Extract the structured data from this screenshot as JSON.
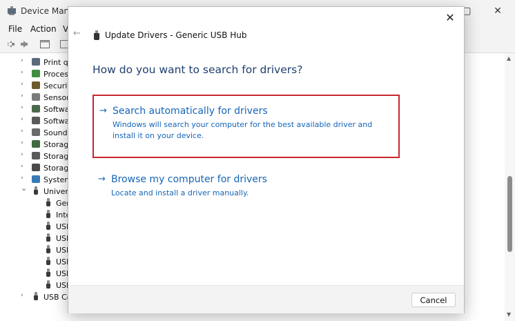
{
  "background_window": {
    "title": "Device Manag",
    "menu": [
      "File",
      "Action",
      "V"
    ],
    "tree_items": [
      {
        "label": "Print qu",
        "indent": 0,
        "expanded": false,
        "icon_color": "#5a6a7a"
      },
      {
        "label": "Process",
        "indent": 0,
        "expanded": false,
        "icon_color": "#3f8f3f"
      },
      {
        "label": "Security",
        "indent": 0,
        "expanded": false,
        "icon_color": "#6b5a2a"
      },
      {
        "label": "Sensors",
        "indent": 0,
        "expanded": false,
        "icon_color": "#7a7a7a"
      },
      {
        "label": "Softwar",
        "indent": 0,
        "expanded": false,
        "icon_color": "#4a6a4a"
      },
      {
        "label": "Softwa",
        "indent": 0,
        "expanded": false,
        "icon_color": "#5a5a5a"
      },
      {
        "label": "Sound,",
        "indent": 0,
        "expanded": false,
        "icon_color": "#6a6a6a"
      },
      {
        "label": "Storage",
        "indent": 0,
        "expanded": false,
        "icon_color": "#3f6a3f"
      },
      {
        "label": "Storage",
        "indent": 0,
        "expanded": false,
        "icon_color": "#5a5a5a"
      },
      {
        "label": "Storage",
        "indent": 0,
        "expanded": false,
        "icon_color": "#4a4a4a"
      },
      {
        "label": "System",
        "indent": 0,
        "expanded": false,
        "icon_color": "#3a7ab8"
      },
      {
        "label": "Univers",
        "indent": 0,
        "expanded": true,
        "icon_color": "usb"
      },
      {
        "label": "Ger",
        "indent": 1,
        "expanded": null,
        "icon_color": "usb"
      },
      {
        "label": "Inte",
        "indent": 1,
        "expanded": null,
        "icon_color": "usb"
      },
      {
        "label": "USB",
        "indent": 1,
        "expanded": null,
        "icon_color": "usb"
      },
      {
        "label": "USB",
        "indent": 1,
        "expanded": null,
        "icon_color": "usb"
      },
      {
        "label": "USB",
        "indent": 1,
        "expanded": null,
        "icon_color": "usb"
      },
      {
        "label": "USB",
        "indent": 1,
        "expanded": null,
        "icon_color": "usb"
      },
      {
        "label": "USB",
        "indent": 1,
        "expanded": null,
        "icon_color": "usb"
      },
      {
        "label": "USB",
        "indent": 1,
        "expanded": null,
        "icon_color": "usb"
      },
      {
        "label": "USB Co",
        "indent": 0,
        "expanded": false,
        "icon_color": "usb"
      }
    ]
  },
  "dialog": {
    "header": "Update Drivers - Generic USB Hub",
    "question": "How do you want to search for drivers?",
    "options": [
      {
        "arrow": "→",
        "title": "Search automatically for drivers",
        "description": "Windows will search your computer for the best available driver and install it on your device.",
        "highlighted": true
      },
      {
        "arrow": "→",
        "title": "Browse my computer for drivers",
        "description": "Locate and install a driver manually.",
        "highlighted": false
      }
    ],
    "cancel_label": "Cancel",
    "close_glyph": "✕",
    "back_glyph": "←"
  },
  "colors": {
    "accent": "#1565b8",
    "question": "#1e3f6e",
    "highlight_border": "#c8262e"
  },
  "icons": {
    "back": "back-arrow-icon",
    "close": "close-icon",
    "device": "usb-device-icon"
  }
}
